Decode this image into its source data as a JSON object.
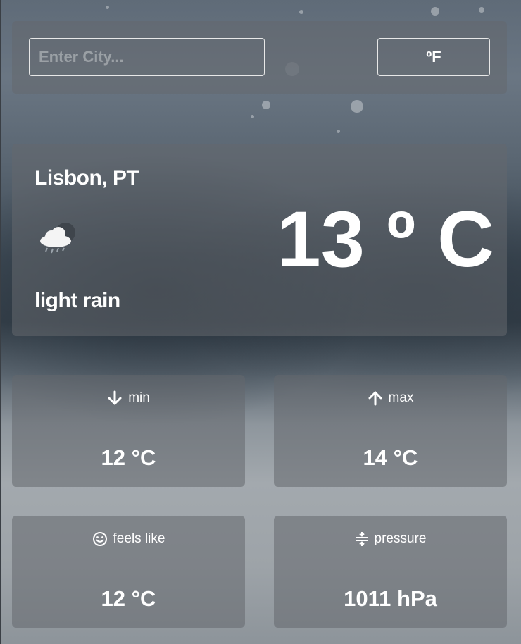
{
  "search": {
    "placeholder": "Enter City...",
    "value": ""
  },
  "unit_toggle": {
    "label": "ºF"
  },
  "current": {
    "location": "Lisbon, PT",
    "icon": "cloud-rain-moon-icon",
    "description": "light rain",
    "temperature": "13 º C"
  },
  "stats": {
    "min": {
      "icon": "arrow-down-icon",
      "label": "min",
      "value": "12 °C"
    },
    "max": {
      "icon": "arrow-up-icon",
      "label": "max",
      "value": "14 °C"
    },
    "feels_like": {
      "icon": "smiley-icon",
      "label": "feels like",
      "value": "12 °C"
    },
    "pressure": {
      "icon": "divide-icon",
      "label": "pressure",
      "value": "1011 hPa"
    }
  },
  "colors": {
    "text": "#ffffff",
    "panel": "#64686e",
    "border": "#e8e8e8"
  }
}
